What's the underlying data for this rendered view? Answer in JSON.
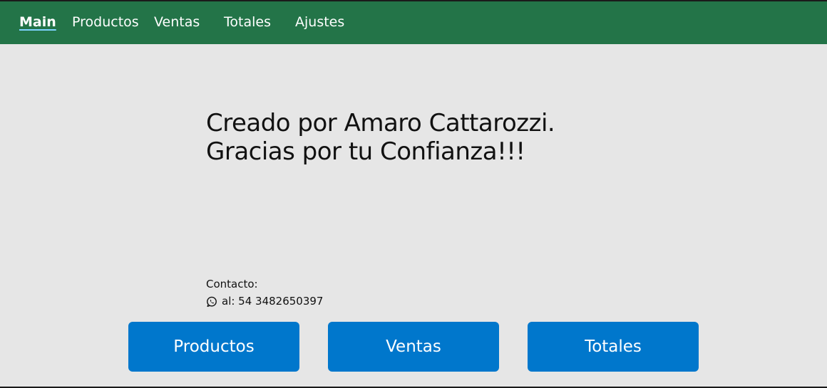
{
  "nav": {
    "items": [
      {
        "label": "Main"
      },
      {
        "label": "Productos"
      },
      {
        "label": "Ventas"
      },
      {
        "label": "Totales"
      },
      {
        "label": "Ajustes"
      }
    ]
  },
  "credits": {
    "line1": "Creado por Amaro Cattarozzi.",
    "line2": "Gracias por tu Confianza!!!"
  },
  "contact": {
    "label": "Contacto:",
    "icon": "whatsapp-icon",
    "phone": "al: 54 3482650397"
  },
  "actions": {
    "productos": "Productos",
    "ventas": "Ventas",
    "totales": "Totales"
  },
  "colors": {
    "navbar": "#237448",
    "background": "#e6e6e6",
    "button": "#0077cc"
  }
}
